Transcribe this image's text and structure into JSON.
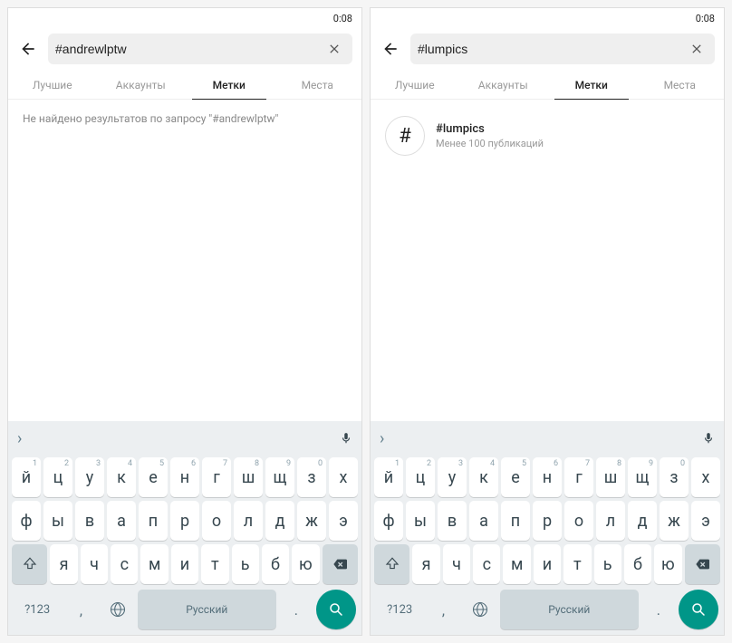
{
  "status_time": "0:08",
  "tabs": [
    "Лучшие",
    "Аккаунты",
    "Метки",
    "Места"
  ],
  "active_tab_index": 2,
  "screens": [
    {
      "search_value": "#andrewlptw",
      "no_results_text": "Не найдено результатов по запросу \"#andrewlptw\"",
      "results": []
    },
    {
      "search_value": "#lumpics",
      "no_results_text": "",
      "results": [
        {
          "name": "#lumpics",
          "sub": "Менее 100 публикаций"
        }
      ]
    }
  ],
  "keyboard": {
    "row1": [
      {
        "main": "й",
        "sup": "1"
      },
      {
        "main": "ц",
        "sup": "2"
      },
      {
        "main": "у",
        "sup": "3"
      },
      {
        "main": "к",
        "sup": "4"
      },
      {
        "main": "е",
        "sup": "5"
      },
      {
        "main": "н",
        "sup": "6"
      },
      {
        "main": "г",
        "sup": "7"
      },
      {
        "main": "ш",
        "sup": "8"
      },
      {
        "main": "щ",
        "sup": "9"
      },
      {
        "main": "з",
        "sup": "0"
      },
      {
        "main": "х",
        "sup": ""
      }
    ],
    "row2": [
      "ф",
      "ы",
      "в",
      "а",
      "п",
      "р",
      "о",
      "л",
      "д",
      "ж",
      "э"
    ],
    "row3": [
      "я",
      "ч",
      "с",
      "м",
      "и",
      "т",
      "ь",
      "б",
      "ю"
    ],
    "num_label": "?123",
    "space_label": "Русский"
  }
}
